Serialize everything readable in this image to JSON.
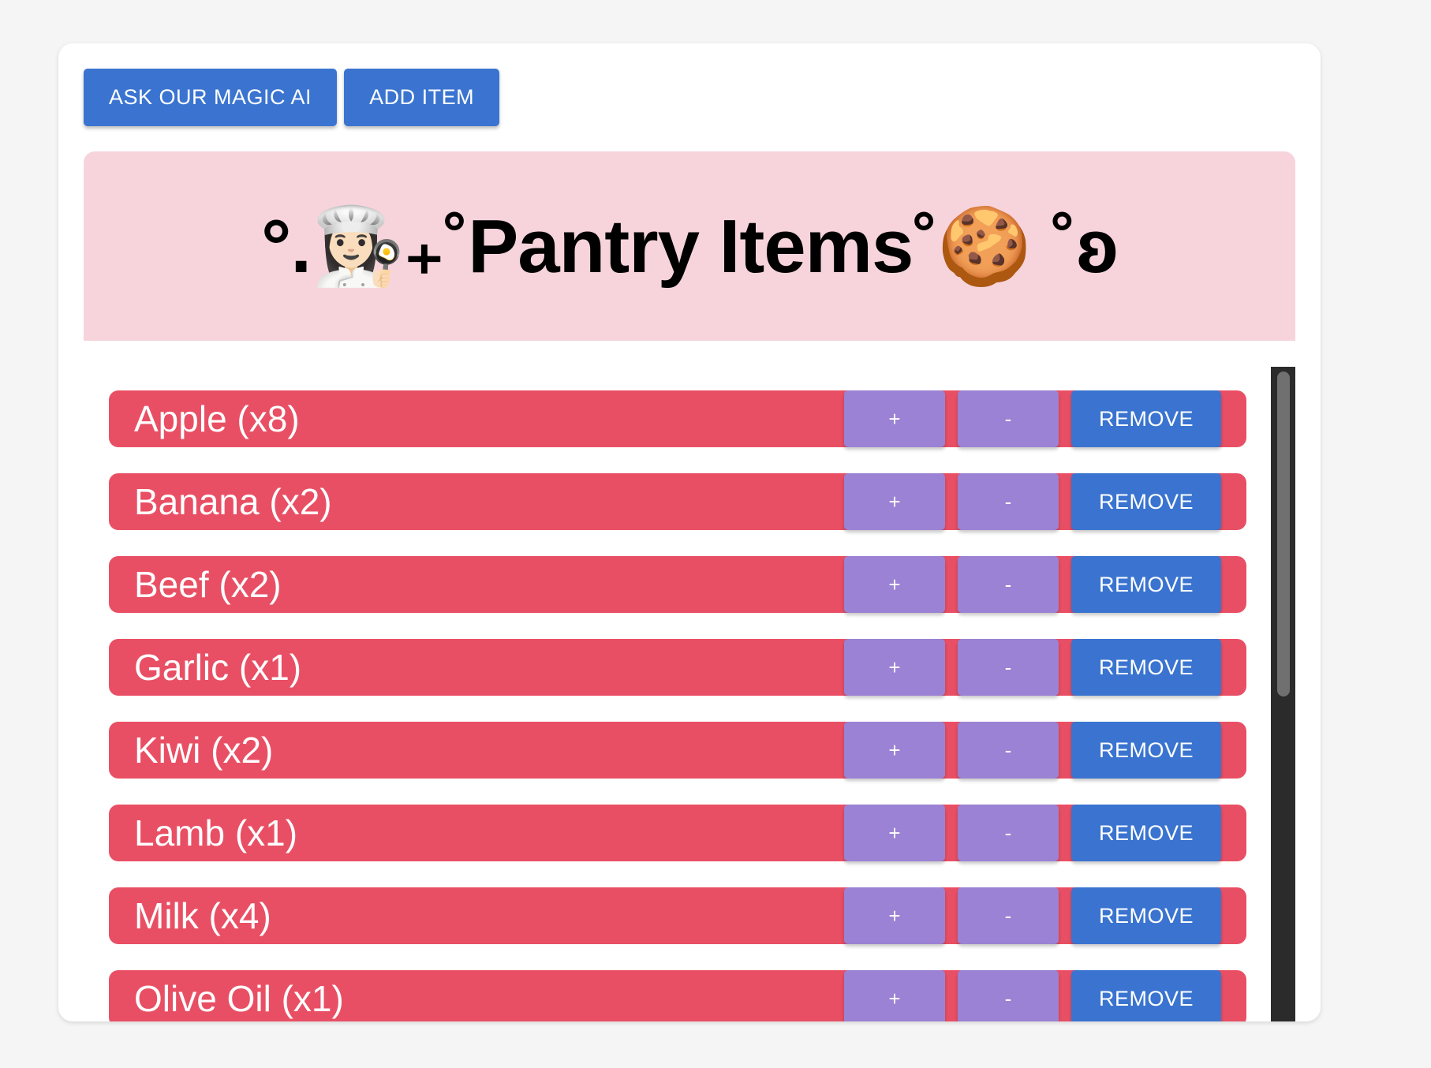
{
  "toolbar": {
    "ask_ai_label": "ASK OUR MAGIC AI",
    "add_item_label": "ADD ITEM"
  },
  "header": {
    "title": "°.👩🏻‍🍳₊˚Pantry Items˚🍪 ˚ʚ"
  },
  "items": [
    {
      "label": "Apple (x8)",
      "plus": "+",
      "minus": "-",
      "remove": "REMOVE"
    },
    {
      "label": "Banana (x2)",
      "plus": "+",
      "minus": "-",
      "remove": "REMOVE"
    },
    {
      "label": "Beef (x2)",
      "plus": "+",
      "minus": "-",
      "remove": "REMOVE"
    },
    {
      "label": "Garlic (x1)",
      "plus": "+",
      "minus": "-",
      "remove": "REMOVE"
    },
    {
      "label": "Kiwi (x2)",
      "plus": "+",
      "minus": "-",
      "remove": "REMOVE"
    },
    {
      "label": "Lamb (x1)",
      "plus": "+",
      "minus": "-",
      "remove": "REMOVE"
    },
    {
      "label": "Milk (x4)",
      "plus": "+",
      "minus": "-",
      "remove": "REMOVE"
    },
    {
      "label": "Olive Oil (x1)",
      "plus": "+",
      "minus": "-",
      "remove": "REMOVE"
    }
  ],
  "colors": {
    "primary_button": "#3a74d0",
    "qty_button": "#9b82d4",
    "item_row": "#e94f64",
    "header_bg": "#f7d4dc",
    "page_bg": "#f5f5f5"
  }
}
